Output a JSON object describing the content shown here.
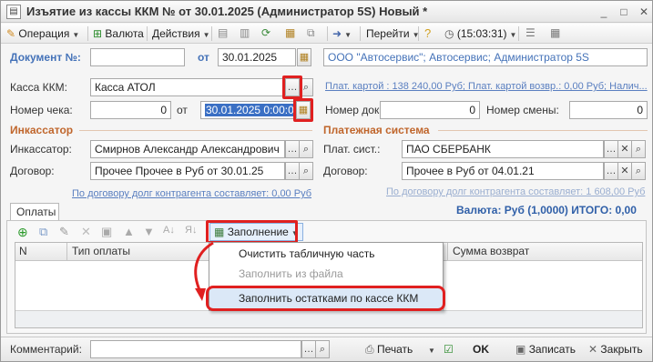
{
  "window": {
    "title": "Изъятие из кассы ККМ №  от 30.01.2025 (Администратор 5S) Новый *",
    "minimize": "_",
    "maximize": "□",
    "close": "✕"
  },
  "toolbar": {
    "operation": "Операция",
    "currency": "Валюта",
    "actions": "Действия",
    "goto": "Перейти",
    "time": "(15:03:31)"
  },
  "header": {
    "document_label": "Документ №:",
    "document_value": "",
    "from_label": "от",
    "date_value": "30.01.2025",
    "org_value": "ООО \"Автосервис\"; Автосервис; Администратор 5S"
  },
  "kkm": {
    "label": "Касса ККМ:",
    "value": "Касса АТОЛ",
    "payment_link": "Плат. картой : 138 240,00 Руб; Плат. картой возвр.: 0,00 Руб; Налич..."
  },
  "check": {
    "label": "Номер чека:",
    "value": "0",
    "from_label": "от",
    "datetime_value": "30.01.2025  0:00:00",
    "doc_no_label": "Номер док.:",
    "doc_no_value": "0",
    "shift_label": "Номер смены:",
    "shift_value": "0"
  },
  "collector": {
    "section": "Инкассатор",
    "label": "Инкассатор:",
    "value": "Смирнов Александр Александрович",
    "contract_label": "Договор:",
    "contract_value": "Прочее Прочее в Руб от 30.01.25",
    "debt_link": "По договору долг контрагента составляет: 0,00 Руб"
  },
  "payment_system": {
    "section": "Платежная система",
    "label": "Плат. сист.:",
    "value": "ПАО СБЕРБАНК",
    "contract_label": "Договор:",
    "contract_value": "Прочее  в Руб от 04.01.21",
    "debt_link": "По договору долг контрагента составляет: 1 608,00 Руб"
  },
  "totals": {
    "text": "Валюта: Руб (1,0000) ИТОГО: 0,00"
  },
  "payments_tab": {
    "label": "Оплаты",
    "fill_button": "Заполнение",
    "columns": [
      "N",
      "Тип оплаты",
      "Сумма возврат"
    ]
  },
  "fill_menu": {
    "items": [
      {
        "label": "Очистить табличную часть",
        "disabled": false
      },
      {
        "label": "Заполнить из файла",
        "disabled": true
      },
      {
        "label": "Заполнить остатками по кассе ККМ",
        "disabled": false
      }
    ]
  },
  "footer": {
    "comment_label": "Комментарий:",
    "comment_value": "",
    "print": "Печать",
    "ok": "OK",
    "save": "Записать",
    "close": "Закрыть"
  },
  "colors": {
    "accent_red": "#e02020",
    "section_orange": "#c0662c",
    "link_blue": "#5a7fc0",
    "label_blue": "#4472b8"
  }
}
